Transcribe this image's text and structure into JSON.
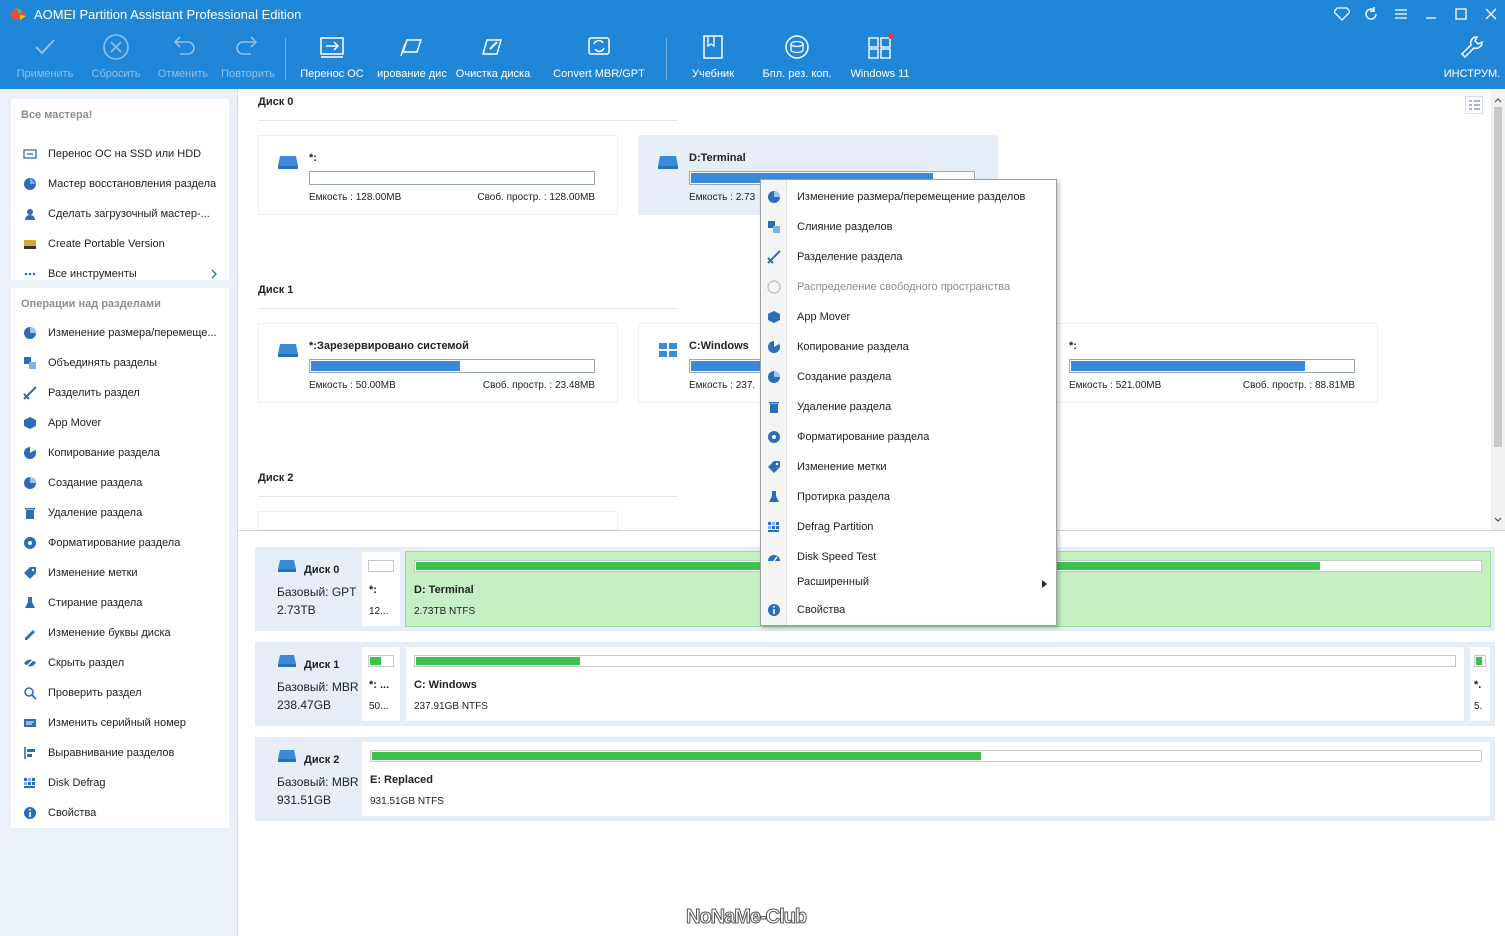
{
  "window": {
    "title": "AOMEI Partition Assistant Professional Edition"
  },
  "toolbar": {
    "apply": "Применить",
    "discard": "Сбросить",
    "undo": "Отменить",
    "redo": "Повторить",
    "migrate_os": "Перенос ОС",
    "clone_disk": "ирование дис",
    "wipe_disk": "Очистка диска",
    "convert": "Convert MBR/GPT",
    "tutorial": "Учебник",
    "backup": "Бпл. рез. коп.",
    "win11": "Windows 11",
    "tools": "ИНСТРУМ."
  },
  "sidebar": {
    "wizards_heading": "Все мастера!",
    "wizards": [
      {
        "label": "Перенос ОС на SSD или HDD",
        "icon": "migrate-icon"
      },
      {
        "label": "Мастер восстановления раздела",
        "icon": "recovery-icon"
      },
      {
        "label": "Сделать загрузочный мастер-...",
        "icon": "bootable-icon"
      },
      {
        "label": "Create Portable Version",
        "icon": "portable-icon"
      },
      {
        "label": "Все инструменты",
        "icon": "more-icon"
      }
    ],
    "ops_heading": "Операции над разделами",
    "ops": [
      {
        "label": "Изменение размера/перемеще...",
        "icon": "resize-icon"
      },
      {
        "label": "Объединять разделы",
        "icon": "merge-icon"
      },
      {
        "label": "Разделить раздел",
        "icon": "split-icon"
      },
      {
        "label": "App Mover",
        "icon": "app-mover-icon"
      },
      {
        "label": "Копирование раздела",
        "icon": "copy-icon"
      },
      {
        "label": "Создание раздела",
        "icon": "create-icon"
      },
      {
        "label": "Удаление раздела",
        "icon": "delete-icon"
      },
      {
        "label": "Форматирование раздела",
        "icon": "format-icon"
      },
      {
        "label": "Изменение метки",
        "icon": "label-icon"
      },
      {
        "label": "Стирание раздела",
        "icon": "wipe-icon"
      },
      {
        "label": "Изменение буквы диска",
        "icon": "letter-icon"
      },
      {
        "label": "Скрыть раздел",
        "icon": "hide-icon"
      },
      {
        "label": "Проверить раздел",
        "icon": "check-icon"
      },
      {
        "label": "Изменить серийный номер",
        "icon": "serial-icon"
      },
      {
        "label": "Выравнивание разделов",
        "icon": "align-icon"
      },
      {
        "label": "Disk Defrag",
        "icon": "defrag-icon"
      },
      {
        "label": "Свойства",
        "icon": "info-icon"
      }
    ]
  },
  "main": {
    "disk0": {
      "heading": "Диск 0",
      "p1": {
        "name": "*:",
        "cap": "Емкость : 128.00MB",
        "free": "Своб. простр. : 128.00MB",
        "used": 0
      },
      "p2": {
        "name": "D:Terminal",
        "cap": "Емкость : 2.73",
        "used": 0.86
      }
    },
    "disk1": {
      "heading": "Диск 1",
      "p1": {
        "name": "*:Зарезервировано системой",
        "cap": "Емкость : 50.00MB",
        "free": "Своб. простр. : 23.48MB",
        "used": 0.53
      },
      "p2": {
        "name": "C:Windows",
        "cap": "Емкость : 237.",
        "used": 0.25
      },
      "p3": {
        "name": "*:",
        "cap": "Емкость : 521.00MB",
        "free": "Своб. простр. : 88.81MB",
        "used": 0.83
      }
    },
    "disk2": {
      "heading": "Диск 2"
    }
  },
  "bottom": {
    "disk0": {
      "name": "Диск 0",
      "type": "Базовый: GPT",
      "size": "2.73TB",
      "parts": [
        {
          "name": "*:",
          "info": "12...",
          "used": 0
        },
        {
          "name": "D: Terminal",
          "info": "2.73TB NTFS",
          "used": 0.85
        }
      ]
    },
    "disk1": {
      "name": "Диск 1",
      "type": "Базовый: MBR",
      "size": "238.47GB",
      "parts": [
        {
          "name": "*: ...",
          "info": "50...",
          "used": 0.53
        },
        {
          "name": "C: Windows",
          "info": "237.91GB NTFS",
          "used": 0.16
        },
        {
          "name": "*.",
          "info": "5.",
          "used": 0.83
        }
      ]
    },
    "disk2": {
      "name": "Диск 2",
      "type": "Базовый: MBR",
      "size": "931.51GB",
      "parts": [
        {
          "name": "E: Replaced",
          "info": "931.51GB NTFS",
          "used": 0.55
        }
      ]
    }
  },
  "context_menu": [
    {
      "label": "Изменение размера/перемещение разделов",
      "icon": "resize-icon"
    },
    {
      "label": "Слияние разделов",
      "icon": "merge-icon"
    },
    {
      "label": "Разделение раздела",
      "icon": "split-icon"
    },
    {
      "label": "Распределение свободного пространства",
      "icon": "allocate-icon",
      "disabled": true
    },
    {
      "label": "App Mover",
      "icon": "app-mover-icon"
    },
    {
      "label": "Копирование раздела",
      "icon": "copy-icon"
    },
    {
      "label": "Создание раздела",
      "icon": "create-icon"
    },
    {
      "label": "Удаление раздела",
      "icon": "delete-icon"
    },
    {
      "label": "Форматирование раздела",
      "icon": "format-icon"
    },
    {
      "label": "Изменение метки",
      "icon": "label-icon"
    },
    {
      "label": "Протирка раздела",
      "icon": "wipe-icon"
    },
    {
      "label": "Defrag Partition",
      "icon": "defrag-icon"
    },
    {
      "label": "Disk Speed Test",
      "icon": "speed-icon"
    },
    {
      "label": "Расширенный",
      "icon": "",
      "submenu": true
    },
    {
      "label": "Свойства",
      "icon": "info-icon"
    }
  ],
  "watermark": "NoNaMe-Club",
  "colors": {
    "accent": "#1f86d8",
    "bar_blue": "#3b8ad9",
    "bar_green": "#3ac34a",
    "selected": "#c4f0c4"
  }
}
